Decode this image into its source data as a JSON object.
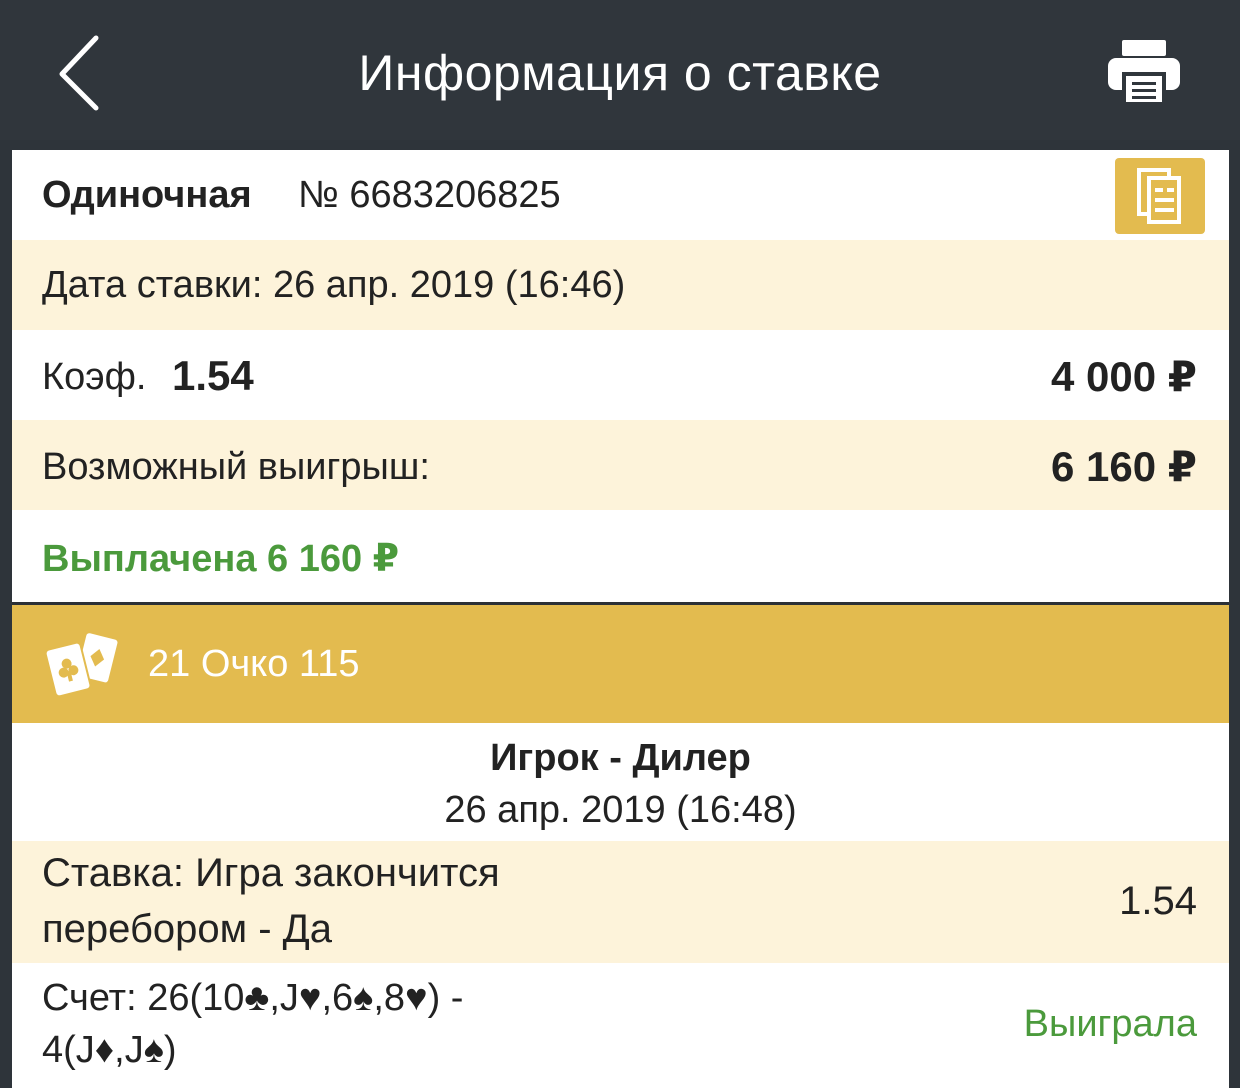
{
  "header": {
    "title": "Информация о ставке",
    "back_icon": "chevron-left-icon",
    "print_icon": "printer-icon"
  },
  "bet": {
    "type_label": "Одиночная",
    "number": "№ 6683206825",
    "copy_icon": "copy-document-icon",
    "date_label": "Дата ставки: 26 апр. 2019 (16:46)",
    "coef_label": "Коэф.",
    "coef_value": "1.54",
    "stake": "4 000 ₽",
    "possible_win_label": "Возможный выигрыш:",
    "possible_win_value": "6 160 ₽",
    "paid_status": "Выплачена 6 160 ₽"
  },
  "event": {
    "game_icon": "playing-cards-icon",
    "game_name": "21 Очко 115",
    "match_name": "Игрок - Дилер",
    "match_date": "26 апр. 2019 (16:48)",
    "selection_line1": "Ставка: Игра закончится",
    "selection_line2": "перебором - Да",
    "selection_coef": "1.54",
    "score_line1": "Счет: 26(10♣,J♥,6♠,8♥) -",
    "score_line2": "4(J♦,J♠)",
    "result": "Выиграла"
  },
  "colors": {
    "header_bg": "#30363c",
    "accent_gold": "#e3bb4f",
    "row_beige": "#fdf3da",
    "win_green": "#4b9a3c"
  }
}
